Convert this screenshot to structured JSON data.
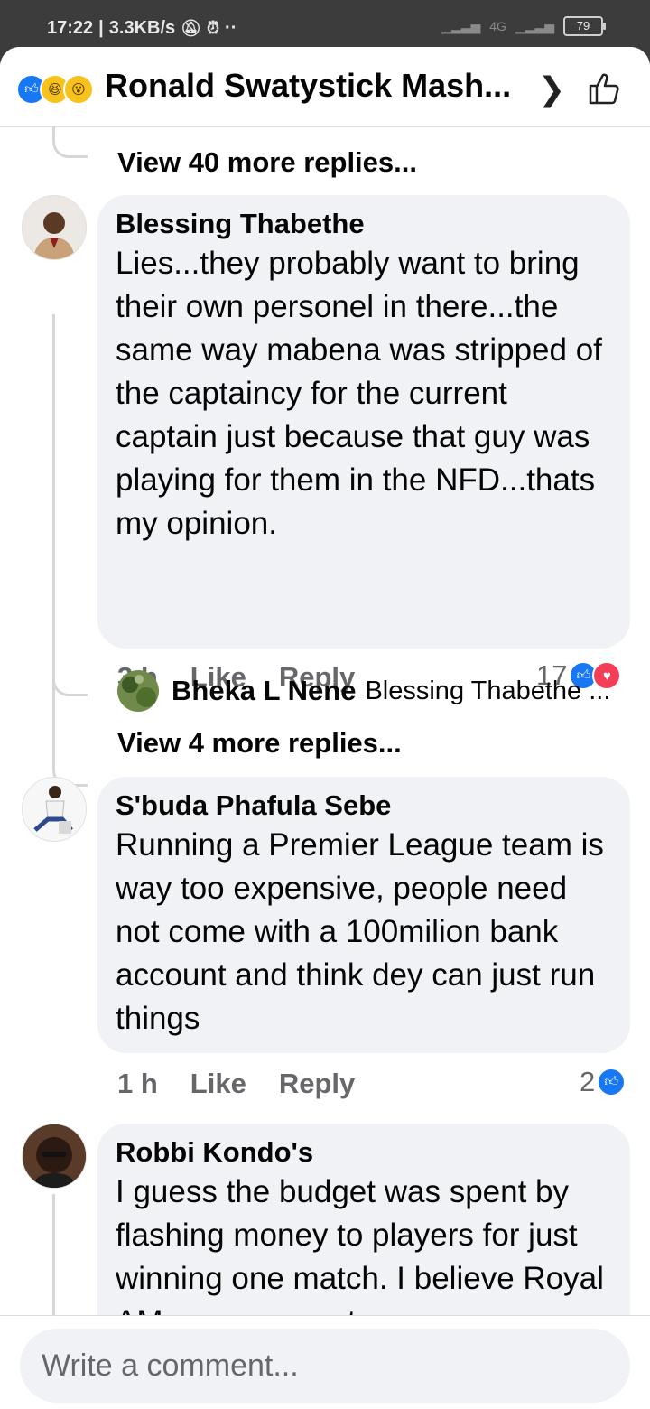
{
  "status_bar": {
    "time": "17:22",
    "speed": "3.3KB/s",
    "network": "4G",
    "battery": "79"
  },
  "header": {
    "title": "Ronald Swatystick Mash..."
  },
  "thread_top": {
    "view_more": "View 40 more replies..."
  },
  "comments": [
    {
      "author": "Blessing Thabethe",
      "text": "Lies...they probably want to bring their own personel in there...the same way mabena was stripped of the captaincy for the current captain just because that guy was playing for them in the NFD...thats my opinion.",
      "time": "3 h",
      "like_label": "Like",
      "reply_label": "Reply",
      "reaction_count": "17",
      "reply_preview": {
        "author": "Bheka L Nene",
        "text": "Blessing Thabethe ..."
      },
      "view_more": "View 4 more replies..."
    },
    {
      "author": "S'buda Phafula Sebe",
      "text": "Running a Premier League team is way too expensive, people need not come with a 100milion bank account and think dey can just run things",
      "time": "1 h",
      "like_label": "Like",
      "reply_label": "Reply",
      "reaction_count": "2"
    },
    {
      "author": "Robbi Kondo's",
      "text": "I guess the budget was spent by flashing money to players for just winning one match. I believe Royal AM management"
    }
  ],
  "composer": {
    "placeholder": "Write a comment..."
  }
}
